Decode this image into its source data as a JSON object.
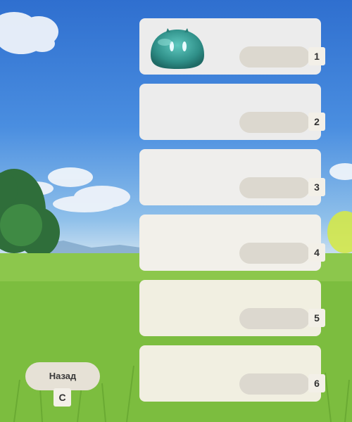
{
  "slots": [
    {
      "key": "1",
      "has_item": true,
      "item_icon": "hydro-slime-icon"
    },
    {
      "key": "2",
      "has_item": false
    },
    {
      "key": "3",
      "has_item": false
    },
    {
      "key": "4",
      "has_item": false
    },
    {
      "key": "5",
      "has_item": false
    },
    {
      "key": "6",
      "has_item": false
    }
  ],
  "back_button": {
    "label": "Назад",
    "key": "C"
  },
  "colors": {
    "slot_background": "#ececec",
    "pill": "#dcd8cf",
    "key_badge": "#f3f0e8",
    "back_button": "#e6e1d6"
  }
}
